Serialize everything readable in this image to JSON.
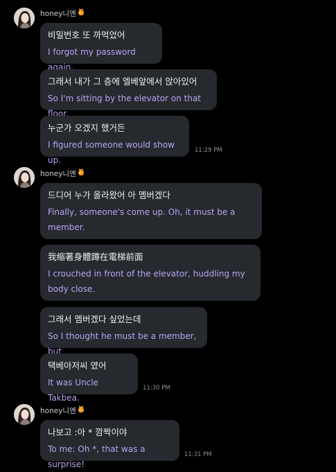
{
  "groups": [
    {
      "sender": "honey니엔",
      "messages": [
        {
          "ko": "비밀번호 또 까먹었어",
          "en": "I forgot my password again."
        },
        {
          "ko": "그래서 내가 그 층에 엘베앞에서 앉아있어",
          "en": "So I'm sitting by the elevator on that floor."
        },
        {
          "ko": "누군가 오겠지 했거든",
          "en": "I figured someone would show up."
        }
      ],
      "timestamp": "11:29 PM"
    },
    {
      "sender": "honey니엔",
      "messages": [
        {
          "ko": "드디어 누가 올라왔어 아 멤버겠다",
          "en": "Finally, someone's come up. Oh, it must be a member."
        },
        {
          "ko": "我缩著身體蹲在電梯前面",
          "en": "I crouched in front of the elevator, huddling my body close."
        },
        {
          "ko": "그래서 멤버겠다 싶었는데",
          "en": "So I thought he must be a member, but"
        },
        {
          "ko": "택베아저씨 였어",
          "en": "It was Uncle Takbea."
        }
      ],
      "timestamp": "11:30 PM"
    },
    {
      "sender": "honey니엔",
      "messages": [
        {
          "ko": "나보고 :아 * 깜짝이야",
          "en": "To me: Oh *, that was a surprise!"
        }
      ],
      "timestamp": "11:31 PM"
    }
  ],
  "icons": {
    "sender_badge": "honey-pot-icon",
    "avatar": "profile-photo"
  },
  "colors": {
    "background": "#000000",
    "bubble": "#26292e",
    "korean_text": "#eef0f3",
    "translation_text": "#b9a6f4",
    "timestamp": "#8d9097"
  }
}
